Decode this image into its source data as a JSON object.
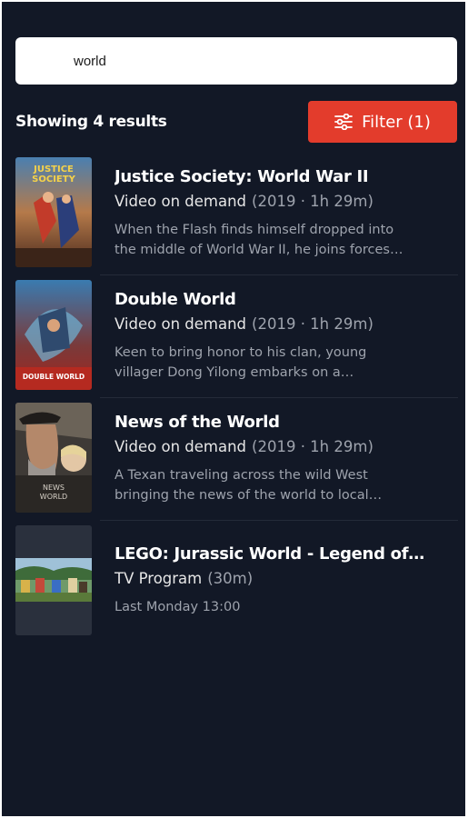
{
  "search": {
    "value": "world",
    "placeholder": ""
  },
  "results": {
    "count_label": "Showing 4 results"
  },
  "filter": {
    "label": "Filter (1)",
    "icon": "sliders-icon"
  },
  "items": [
    {
      "title": "Justice Society: World War II",
      "type": "Video on demand",
      "detail": "(2019 · 1h 29m)",
      "desc_line1": "When the Flash finds himself dropped into",
      "desc_line2": "the middle of World War II, he joins forces…",
      "thumb_text": "JUSTICE SOCIETY"
    },
    {
      "title": "Double World",
      "type": "Video on demand",
      "detail": "(2019 · 1h 29m)",
      "desc_line1": "Keen to bring honor to his clan, young",
      "desc_line2": "villager Dong Yilong embarks on a…",
      "thumb_text": "DOUBLE WORLD"
    },
    {
      "title": "News of the World",
      "type": "Video on demand",
      "detail": "(2019 · 1h 29m)",
      "desc_line1": "A Texan traveling across the wild West",
      "desc_line2": "bringing the news of the world to local…",
      "thumb_text": "NEWS WORLD"
    },
    {
      "title": "LEGO: Jurassic World - Legend of …",
      "type": "TV Program",
      "detail": "(30m)",
      "airtime": "Last Monday 13:00"
    }
  ],
  "colors": {
    "background": "#121826",
    "accent": "#e33c2c",
    "muted": "#9ea3ad"
  }
}
